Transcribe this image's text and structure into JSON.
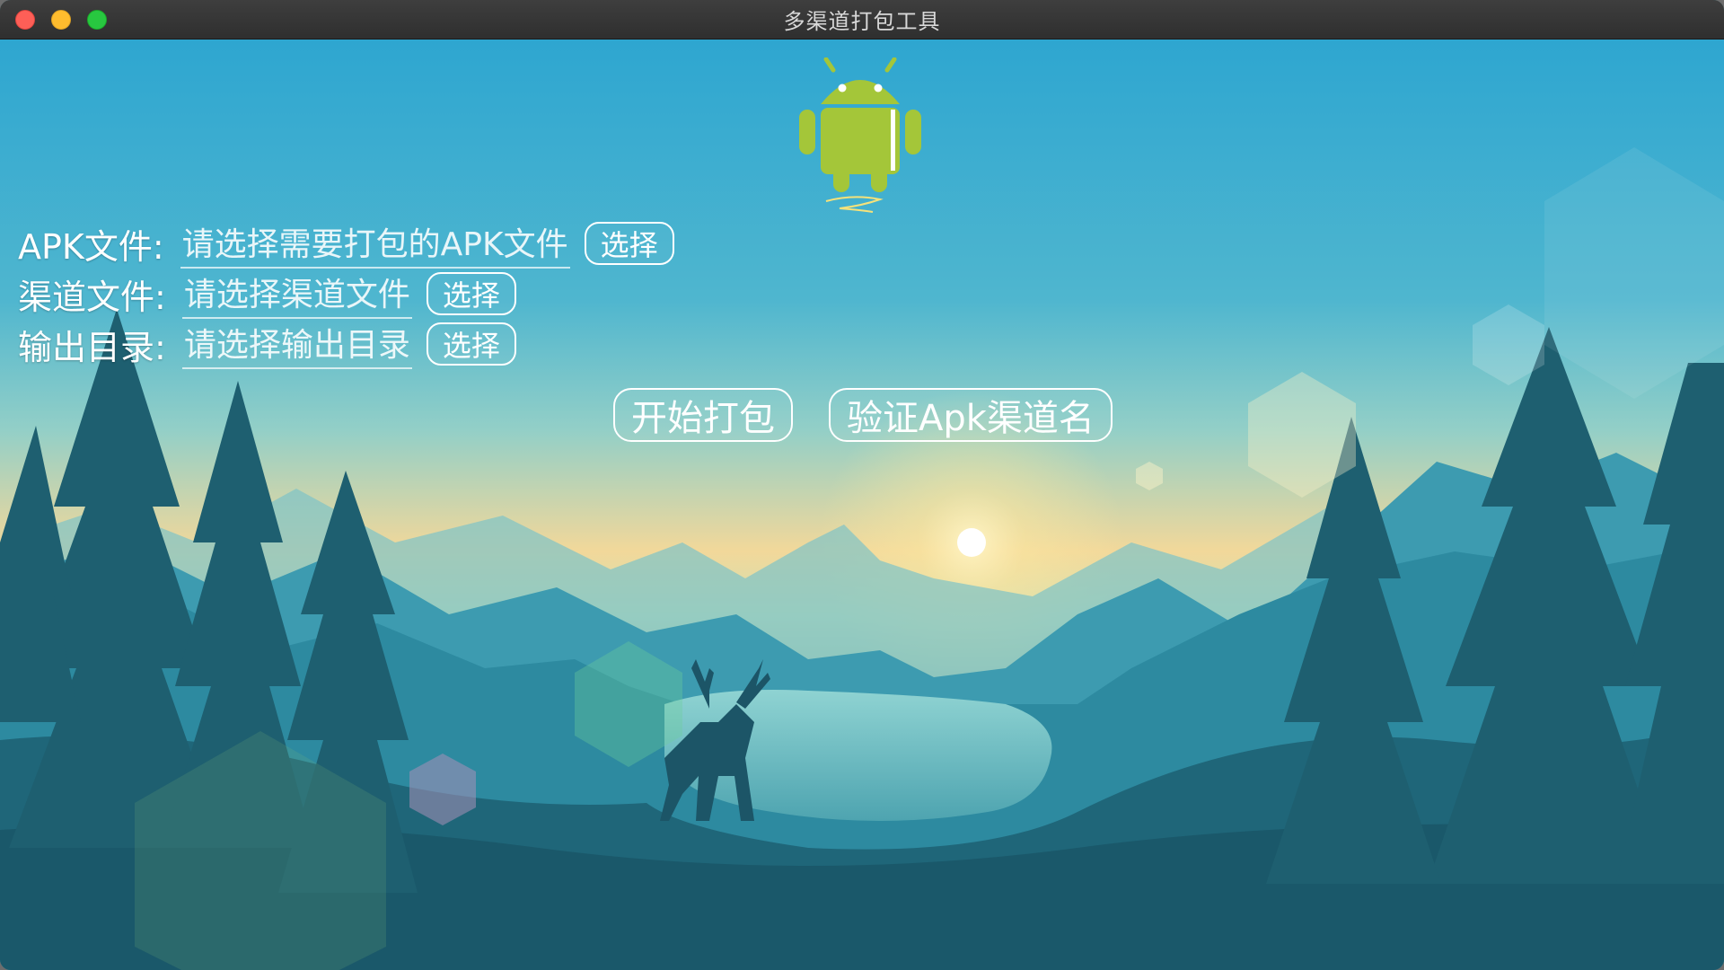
{
  "window": {
    "title": "多渠道打包工具"
  },
  "form": {
    "apk": {
      "label": "APK文件:",
      "placeholder": "请选择需要打包的APK文件",
      "button": "选择"
    },
    "channel": {
      "label": "渠道文件:",
      "placeholder": "请选择渠道文件",
      "button": "选择"
    },
    "output": {
      "label": "输出目录:",
      "placeholder": "请选择输出目录",
      "button": "选择"
    }
  },
  "actions": {
    "start": "开始打包",
    "verify": "验证Apk渠道名"
  },
  "colors": {
    "accent": "#a4c639",
    "sky_top": "#2ea6d0",
    "horizon": "#f2d89a",
    "ground": "#1d5c6e"
  },
  "icons": {
    "logo": "android-robot-icon"
  }
}
